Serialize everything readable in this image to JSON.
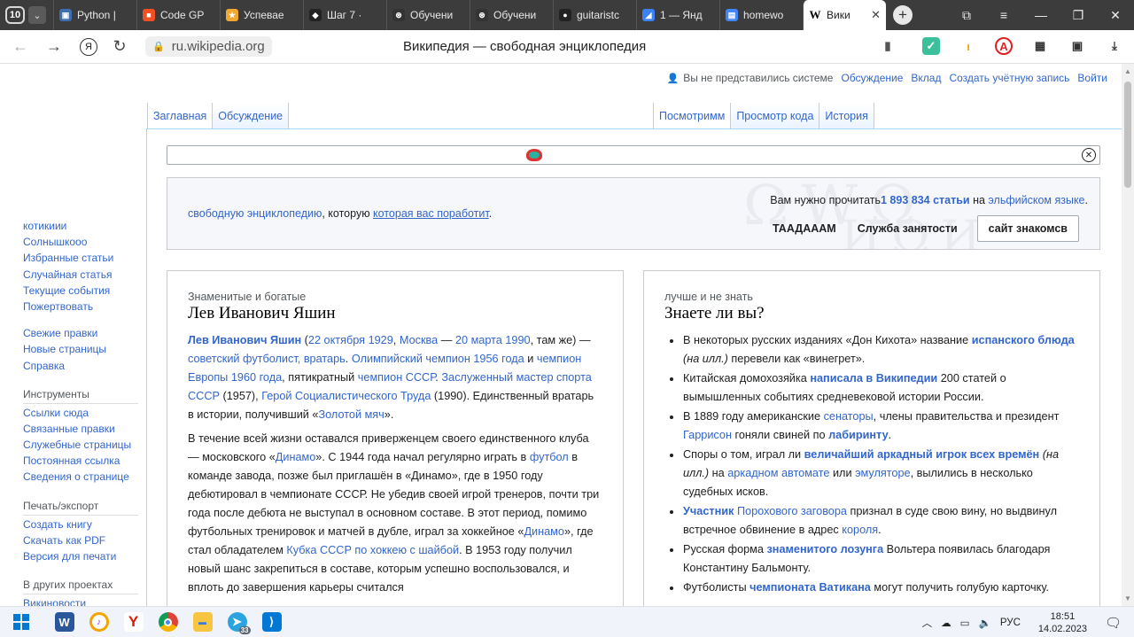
{
  "browser": {
    "tab_count": "10",
    "tabs": [
      {
        "label": "Python |",
        "fav_color": "#3d6fb0",
        "fav_glyph": "▣"
      },
      {
        "label": "Code GP",
        "fav_color": "#f25022",
        "fav_glyph": "■"
      },
      {
        "label": "Успевае",
        "fav_color": "#f0a830",
        "fav_glyph": "★"
      },
      {
        "label": "Шаг 7 ·",
        "fav_color": "#222222",
        "fav_glyph": "◆"
      },
      {
        "label": "Обучени",
        "fav_color": "#333333",
        "fav_glyph": "⊛"
      },
      {
        "label": "Обучени",
        "fav_color": "#333333",
        "fav_glyph": "⊛"
      },
      {
        "label": "guitaristc",
        "fav_color": "#222222",
        "fav_glyph": "●"
      },
      {
        "label": "1 — Янд",
        "fav_color": "#3b82f6",
        "fav_glyph": "◢"
      },
      {
        "label": "homewo",
        "fav_color": "#4285f4",
        "fav_glyph": "▤"
      },
      {
        "label": "Вики",
        "fav_color": "#ffffff",
        "fav_glyph": "W",
        "active": true
      }
    ],
    "url": "ru.wikipedia.org",
    "page_title": "Википедия — свободная энциклопедия"
  },
  "personal": {
    "not_logged": "Вы не представились системе",
    "talk": "Обсуждение",
    "contrib": "Вклад",
    "create": "Создать учётную запись",
    "login": "Войти"
  },
  "page_tabs": {
    "main": "Заглавная",
    "discussion": "Обсуждение",
    "read": "Посмотримм",
    "view_source": "Просмотр кода",
    "history": "История"
  },
  "welcome": {
    "left_link1": "свободную энциклопедию",
    "left_text": ", которую ",
    "left_link2": "которая вас поработит",
    "left_end": ".",
    "right_prefix": "Вам нужно прочитать",
    "right_count": "1 893 834 статьи",
    "right_mid": " на ",
    "right_link": "эльфийском языке",
    "right_end": ".",
    "btn1": "ТААДАААМ",
    "btn2": "Служба занятости",
    "btn3": "сайт знакомсв"
  },
  "featured": {
    "eyebrow": "Знаменитые и богатые",
    "title": "Лев Иванович Яшин",
    "p1": {
      "name": "Лев Иванович Яшин",
      "open": " (",
      "date1": "22 октября 1929",
      "comma": ", ",
      "place1": "Москва",
      "dash": " — ",
      "date2": "20 марта 1990",
      "t1": ", там же) — ",
      "link1": "советский футболист, вратарь",
      "t2": ". ",
      "link2": "Олимпийский чемпион 1956 года",
      "t3": " и ",
      "link3": "чемпион Европы 1960 года",
      "t4": ", пятикратный ",
      "link4": "чемпион СССР",
      "t5": ". ",
      "link5": "Заслуженный мастер спорта СССР",
      "t6": " (1957), ",
      "link6": "Герой Социалистического Труда",
      "t7": " (1990). Единственный вратарь в истории, получивший «",
      "link7": "Золотой мяч",
      "t8": "»."
    },
    "p2": {
      "t1": "В течение всей жизни оставался приверженцем своего единственного клуба — московского «",
      "link1": "Динамо",
      "t2": "». С 1944 года начал регулярно играть в ",
      "link2": "футбол",
      "t3": " в команде завода, позже был приглашён в «Динамо», где в 1950 году дебютировал в чемпионате СССР. Не убедив своей игрой тренеров, почти три года после дебюта не выступал в основном составе. В этот период, помимо футбольных тренировок и матчей в дубле, играл за хоккейное «",
      "link3": "Динамо",
      "t4": "», где стал обладателем ",
      "link4": "Кубка СССР по хоккею с шайбой",
      "t5": ". В 1953 году получил новый шанс закрепиться в составе, которым успешно воспользовался, и вплоть до завершения карьеры считался"
    }
  },
  "dyk": {
    "eyebrow": "лучше и не знать",
    "title": "Знаете ли вы?",
    "items": [
      {
        "a": "В некоторых русских изданиях «Дон Кихота» название ",
        "b": "испанского блюда",
        "c": " ",
        "d": "(на илл.)",
        "e": " перевели как «винегрет»."
      },
      {
        "a": "Китайская домохозяйка ",
        "b": "написала в Википедии",
        "c": " 200 статей о вымышленных событиях средневековой истории России."
      },
      {
        "a": "В 1889 году американские ",
        "l1": "сенаторы",
        "b2": ", члены правительства и президент ",
        "l2": "Гаррисон",
        "c2": " гоняли свиней по ",
        "l3": "лабиринту",
        "d2": "."
      },
      {
        "a": "Споры о том, играл ли ",
        "b": "величайший аркадный игрок всех времён",
        "c": " ",
        "d": "(на илл.)",
        "e": " на ",
        "l1": "аркадном автомате",
        "f": " или ",
        "l2": "эмуляторе",
        "g": ", вылились в несколько судебных исков."
      },
      {
        "l0": "Участник",
        "a": " ",
        "l1": "Порохового заговора",
        "b": " признал в суде свою вину, но выдвинул встречное обвинение в адрес ",
        "l2": "короля",
        "c": "."
      },
      {
        "a": "Русская форма ",
        "b": "знаменитого лозунга",
        "c": " Вольтера появилась благодаря Константину Бальмонту."
      },
      {
        "a": "Футболисты ",
        "b": "чемпионата Ватикана",
        "c": " могут получить голубую карточку."
      }
    ]
  },
  "sidebar": {
    "nav": [
      "котикиии",
      "Солнышкооо",
      "Избранные статьи",
      "Случайная статья",
      "Текущие события",
      "Пожертвовать"
    ],
    "nav2": [
      "Свежие правки",
      "Новые страницы",
      "Справка"
    ],
    "tools_head": "Инструменты",
    "tools": [
      "Ссылки сюда",
      "Связанные правки",
      "Служебные страницы",
      "Постоянная ссылка",
      "Сведения о странице"
    ],
    "print_head": "Печать/экспорт",
    "print": [
      "Создать книгу",
      "Скачать как PDF",
      "Версия для печати"
    ],
    "other_head": "В других проектах",
    "other": [
      "Викиновости"
    ]
  },
  "taskbar": {
    "lang": "РУС",
    "time": "18:51",
    "date": "14.02.2023",
    "telegram_badge": "33"
  },
  "colors": {
    "link": "#3366cc",
    "tabbar_bg": "#3c3c3c",
    "taskbar_bg": "#f0f3f9"
  }
}
